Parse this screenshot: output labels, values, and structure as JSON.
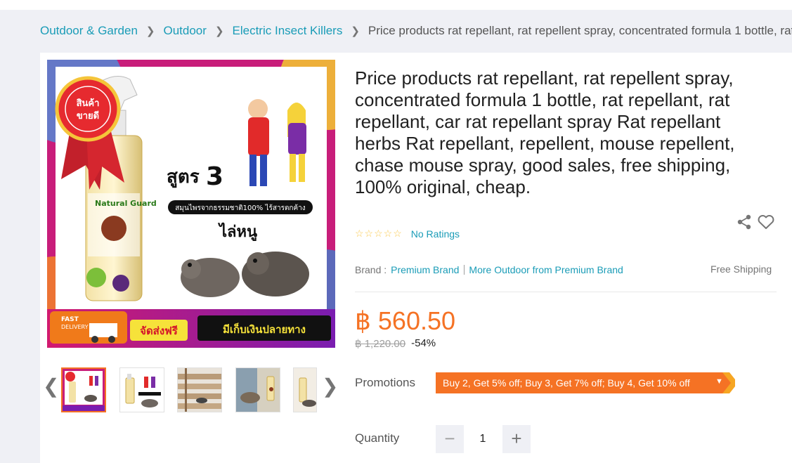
{
  "breadcrumb": {
    "items": [
      "Outdoor & Garden",
      "Outdoor",
      "Electric Insect Killers"
    ],
    "current": "Price products rat repellant, rat repellent spray, concentrated formula 1 bottle, rat"
  },
  "gallery": {
    "main_image_icon": "product-image",
    "badge_text": "สินค้าขายดี",
    "formula_text": "สูตร3",
    "herb_text": "สมุนไพรจากธรรมชาติ100% ไร้สารตกค้าง",
    "repel_text": "ไล่หนู",
    "delivery_text": "FAST DELIVERY",
    "free_ship_text": "จัดส่งฟรี",
    "cod_text": "มีเก็บเงินปลายทาง",
    "bottle_brand": "Natural Guard"
  },
  "product": {
    "title": "Price products rat repellant, rat repellent spray, concentrated formula 1 bottle, rat repellant, rat repellant, car rat repellant spray Rat repellant herbs Rat repellant, repellent, mouse repellent, chase mouse spray, good sales, free shipping, 100% original, cheap.",
    "rating_stars": "☆☆☆☆☆",
    "rating_text": "No Ratings",
    "brand_label": "Brand :",
    "brand_name": "Premium Brand",
    "more_from": "More Outdoor from Premium Brand",
    "free_shipping": "Free Shipping",
    "price": "฿ 560.50",
    "original_price": "฿ 1,220.00",
    "discount": "-54%",
    "promotions_label": "Promotions",
    "promotion_text": "Buy 2, Get 5% off; Buy 3, Get 7% off; Buy 4, Get 10% off",
    "quantity_label": "Quantity",
    "quantity_value": "1"
  },
  "colors": {
    "accent": "#f57224",
    "link": "#1a9cb7",
    "background": "#eff0f5"
  },
  "icons": {
    "share": "share-icon",
    "wishlist": "heart-icon",
    "prev": "chevron-left-icon",
    "next": "chevron-right-icon",
    "minus": "minus-icon",
    "plus": "plus-icon"
  }
}
